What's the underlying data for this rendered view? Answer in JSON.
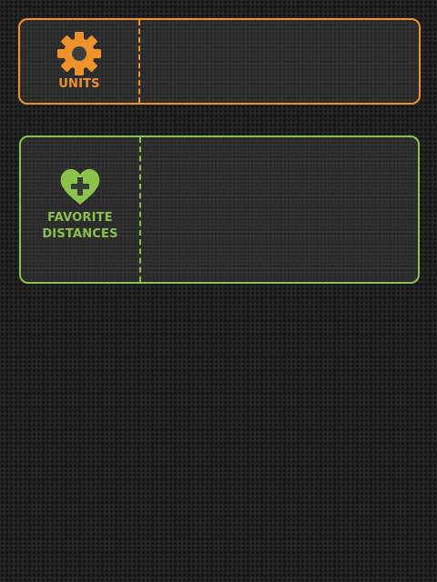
{
  "colors": {
    "units_accent": "#f0922c",
    "favorites_accent": "#8bc34a",
    "background": "#262626"
  },
  "units_panel": {
    "icon": "gear-icon",
    "label": "UNITS"
  },
  "favorites_panel": {
    "icon": "heart-plus-icon",
    "label": "FAVORITE\nDISTANCES"
  }
}
